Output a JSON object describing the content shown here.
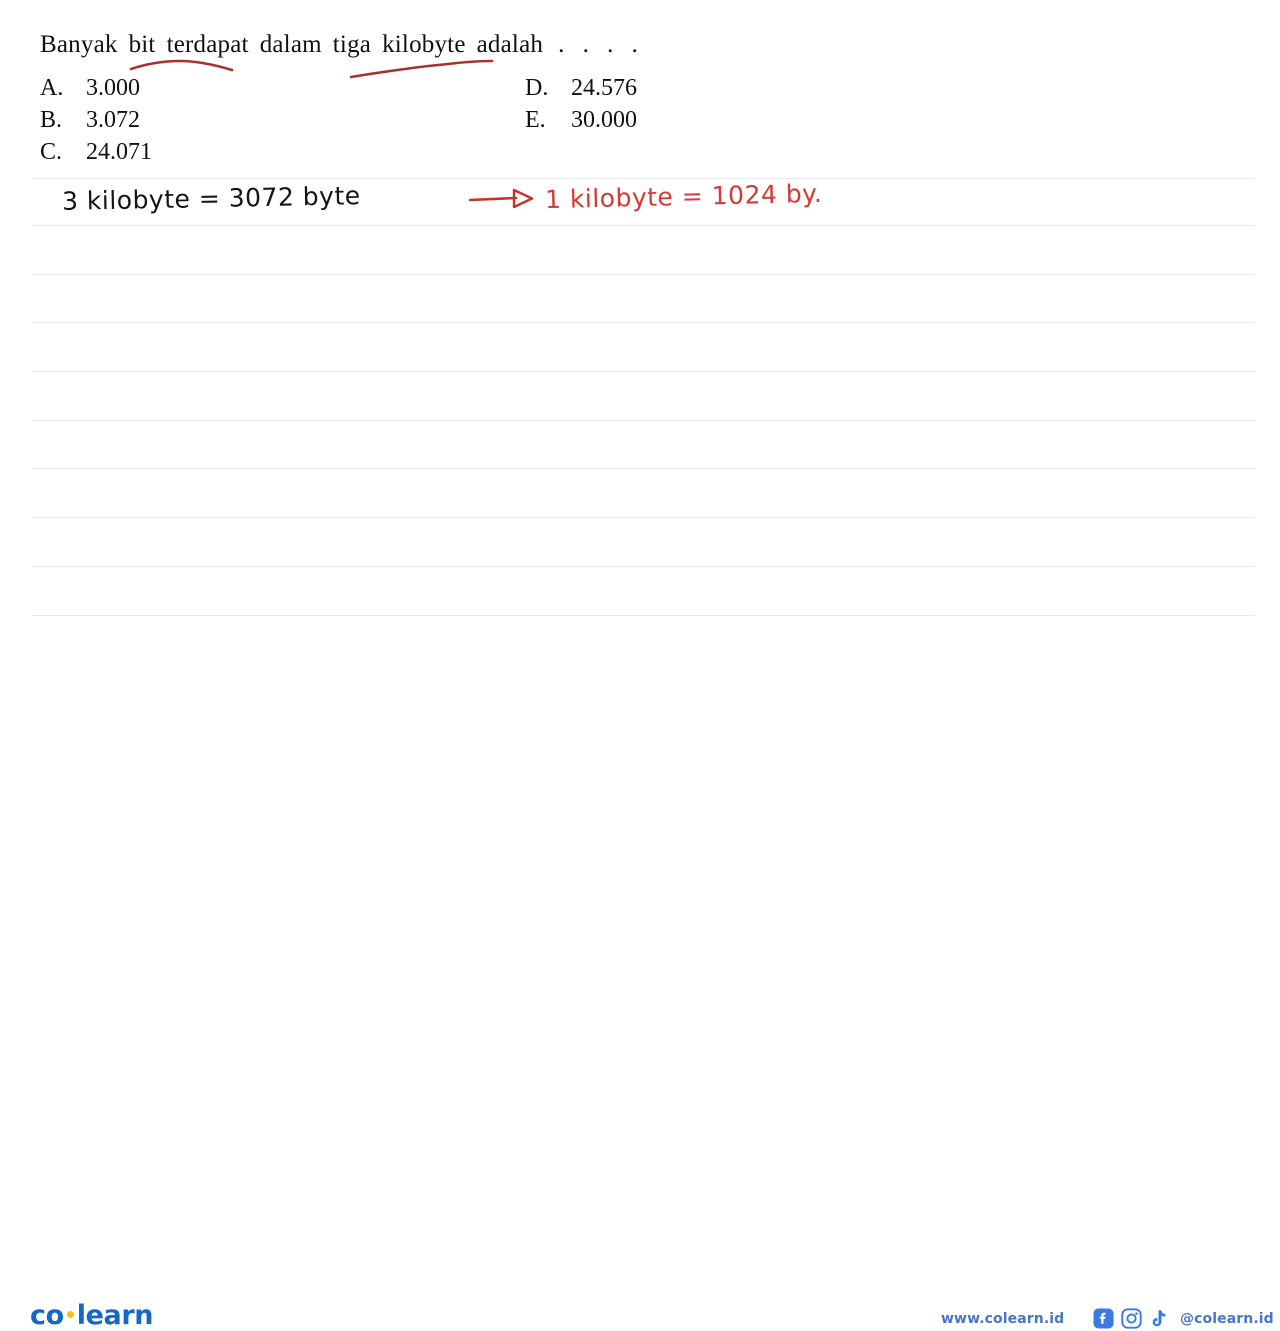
{
  "page": {
    "background_color": "#ffffff",
    "rule_line_color": "#e9e9e9",
    "rule_line_ys": [
      178,
      225,
      274,
      322,
      371,
      420,
      468,
      517,
      566,
      615
    ]
  },
  "question": {
    "words": [
      "Banyak",
      "bit",
      "terdapat",
      "dalam",
      "tiga",
      "kilobyte",
      "adalah"
    ],
    "full_text": "Banyak bit terdapat dalam tiga kilobyte adalah . . . .",
    "ellipsis": ". . . .",
    "annotation_color": "#a8312e",
    "underlines": [
      {
        "target": "bit",
        "name": "underline-bit"
      },
      {
        "target": "kilobyte",
        "name": "underline-kilobyte"
      }
    ]
  },
  "options": {
    "left": [
      {
        "label": "A.",
        "value": "3.000"
      },
      {
        "label": "B.",
        "value": "3.072"
      },
      {
        "label": "C.",
        "value": "24.071"
      }
    ],
    "right": [
      {
        "label": "D.",
        "value": "24.576"
      },
      {
        "label": "E.",
        "value": "30.000"
      }
    ]
  },
  "handwriting": {
    "black_note": "3 kilobyte = 3072 byte",
    "black_color": "#141414",
    "arrow": "arrow-right",
    "red_note": "1 kilobyte = 1024 by.",
    "red_color": "#d33a34"
  },
  "footer": {
    "logo": {
      "part1": "co",
      "part2": "learn",
      "color": "#1668c4",
      "dot_color": "#f5c026"
    },
    "website": "www.colearn.id",
    "handle": "@colearn.id",
    "text_color": "#4a74c9",
    "socials": [
      {
        "name": "facebook-icon",
        "label": "Facebook"
      },
      {
        "name": "instagram-icon",
        "label": "Instagram"
      },
      {
        "name": "tiktok-icon",
        "label": "TikTok"
      }
    ]
  }
}
